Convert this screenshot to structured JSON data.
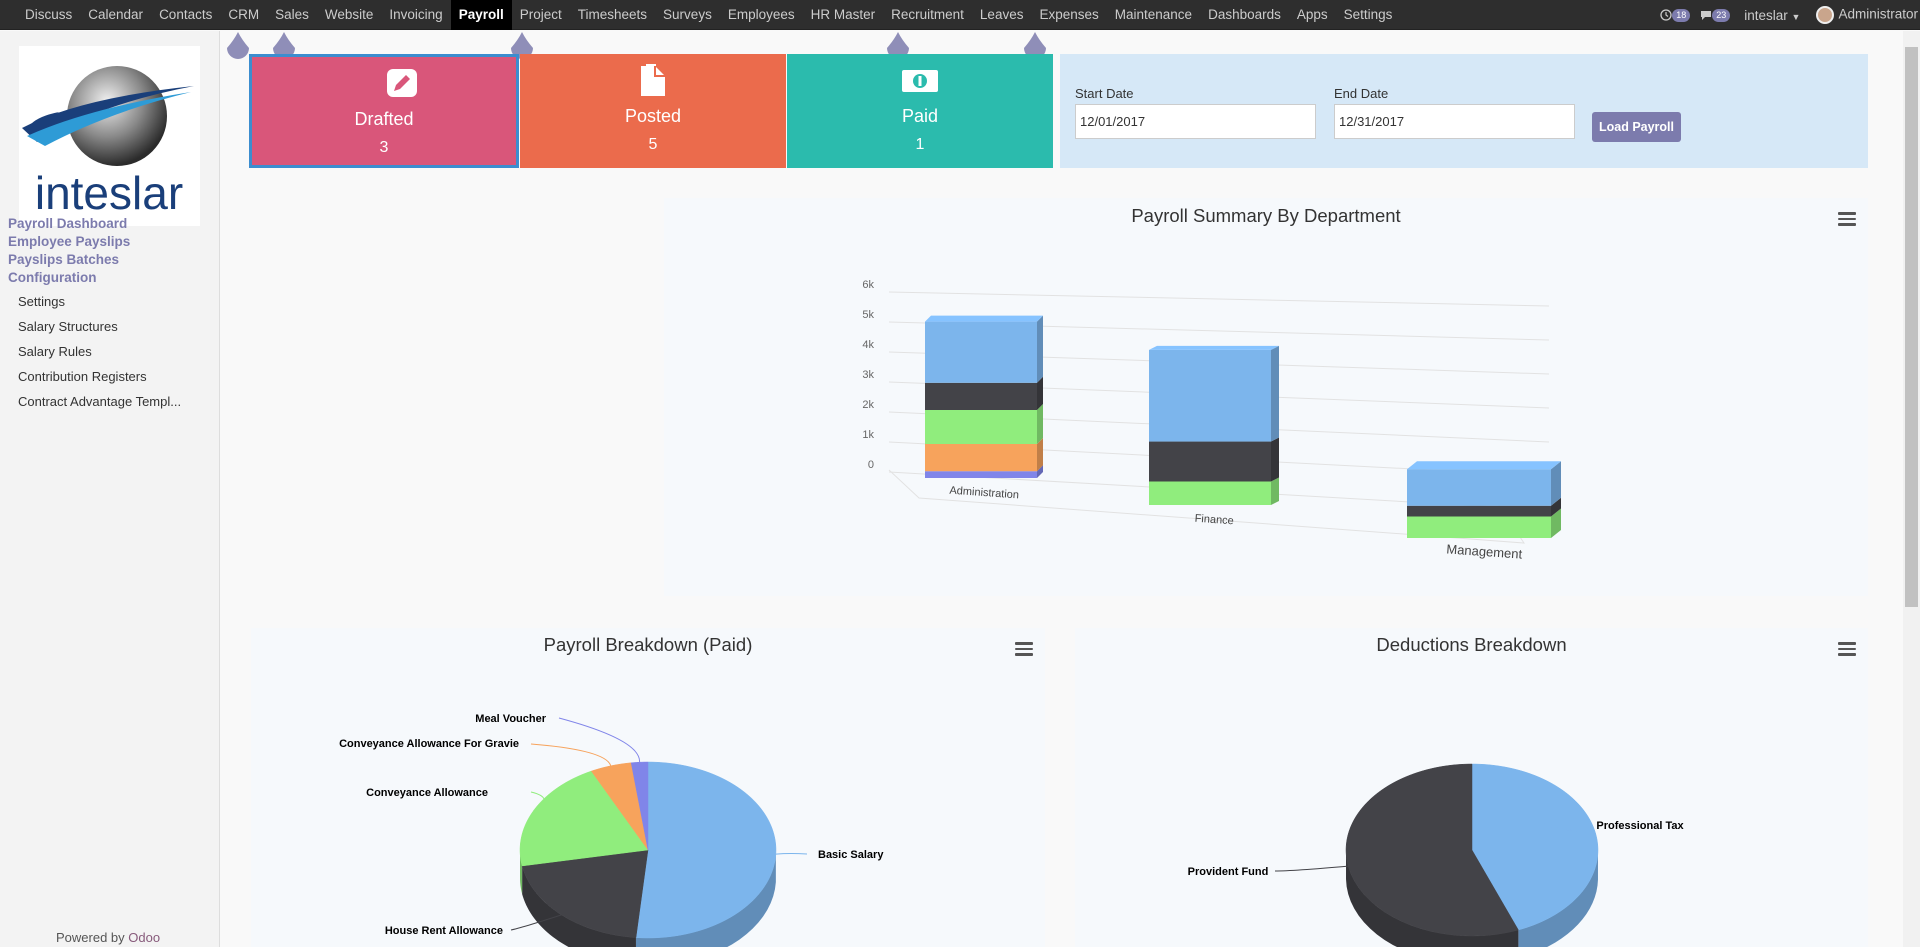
{
  "topbar": {
    "apps": [
      "Discuss",
      "Calendar",
      "Contacts",
      "CRM",
      "Sales",
      "Website",
      "Invoicing",
      "Payroll",
      "Project",
      "Timesheets",
      "Surveys",
      "Employees",
      "HR Master",
      "Recruitment",
      "Leaves",
      "Expenses",
      "Maintenance",
      "Dashboards",
      "Apps",
      "Settings"
    ],
    "active_app": "Payroll",
    "activity_count": "18",
    "message_count": "23",
    "company": "inteslar",
    "user": "Administrator"
  },
  "sidebar": {
    "logo_text": "inteslar",
    "menu": [
      {
        "label": "Payroll Dashboard",
        "level": 1
      },
      {
        "label": "Employee Payslips",
        "level": 1
      },
      {
        "label": "Payslips Batches",
        "level": 1
      },
      {
        "label": "Configuration",
        "level": 1
      },
      {
        "label": "Settings",
        "level": 2
      },
      {
        "label": "Salary Structures",
        "level": 2
      },
      {
        "label": "Salary Rules",
        "level": 2
      },
      {
        "label": "Contribution Registers",
        "level": 2
      },
      {
        "label": "Contract Advantage Templ...",
        "level": 2
      }
    ],
    "powered_prefix": "Powered by",
    "powered_brand": "Odoo"
  },
  "stats": [
    {
      "label": "Drafted",
      "count": "3",
      "color": "#d9567a",
      "icon": "pencil-icon"
    },
    {
      "label": "Posted",
      "count": "5",
      "color": "#eb6b4c",
      "icon": "document-icon"
    },
    {
      "label": "Paid",
      "count": "1",
      "color": "#2bbbad",
      "icon": "money-icon"
    }
  ],
  "filters": {
    "start_label": "Start Date",
    "start_value": "12/01/2017",
    "end_label": "End Date",
    "end_value": "12/31/2017",
    "load_button": "Load Payroll"
  },
  "charts": {
    "summary_title": "Payroll Summary By Department",
    "paid_title": "Payroll Breakdown (Paid)",
    "deductions_title": "Deductions Breakdown"
  },
  "chart_data": [
    {
      "type": "bar",
      "stacked": true,
      "three_d": true,
      "title": "Payroll Summary By Department",
      "categories": [
        "Administration",
        "Finance",
        "Management"
      ],
      "y_ticks": [
        "0",
        "1k",
        "2k",
        "3k",
        "4k",
        "5k",
        "6k"
      ],
      "ylim": [
        0,
        6000
      ],
      "series": [
        {
          "values": [
            200,
            0,
            0
          ],
          "color": "#8085e9"
        },
        {
          "values": [
            800,
            0,
            0
          ],
          "color": "#f7a35c"
        },
        {
          "values": [
            1000,
            1000,
            1000
          ],
          "color": "#90ed7d"
        },
        {
          "values": [
            800,
            1700,
            500
          ],
          "color": "#434348"
        },
        {
          "values": [
            1800,
            3900,
            1700
          ],
          "color": "#7cb5ec"
        }
      ],
      "grid": true
    },
    {
      "type": "pie",
      "three_d": true,
      "title": "Payroll Breakdown (Paid)",
      "slices": [
        {
          "label": "Basic Salary",
          "value": 51.5,
          "color": "#7cb5ec"
        },
        {
          "label": "House Rent Allowance",
          "value": 20.6,
          "color": "#434348"
        },
        {
          "label": "Conveyance Allowance",
          "value": 20.6,
          "color": "#90ed7d"
        },
        {
          "label": "Conveyance Allowance For Gravie",
          "value": 5.2,
          "color": "#f7a35c"
        },
        {
          "label": "Meal Voucher",
          "value": 2.1,
          "color": "#8085e9"
        }
      ]
    },
    {
      "type": "pie",
      "three_d": true,
      "title": "Deductions Breakdown",
      "slices": [
        {
          "label": "Professional Tax",
          "value": 44,
          "color": "#7cb5ec"
        },
        {
          "label": "Provident Fund",
          "value": 56,
          "color": "#434348"
        }
      ]
    }
  ]
}
